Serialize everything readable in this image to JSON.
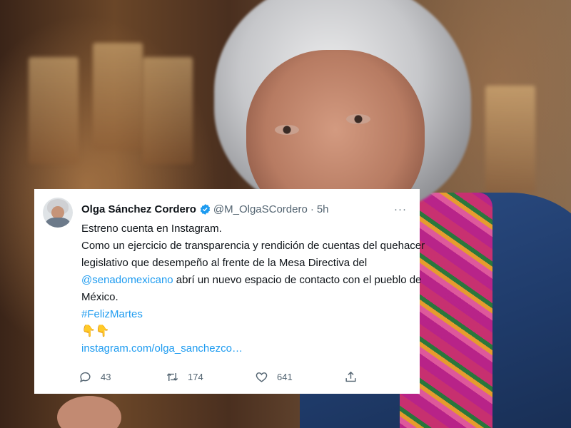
{
  "tweet": {
    "author_name": "Olga Sánchez Cordero",
    "handle": "@M_OlgaSCordero",
    "separator": "·",
    "time": "5h",
    "more": "···",
    "lines": [
      "Estreno cuenta en Instagram.",
      "Como un ejercicio de transparencia y rendición de cuentas del quehacer",
      "legislativo que desempeño al frente de la Mesa Directiva del"
    ],
    "mention": "@senadomexicano",
    "mention_rest": " abrí un nuevo espacio de contacto con el pueblo de",
    "line_mexico": "México.",
    "hashtag": "#FelizMartes",
    "emoji": "👇👇",
    "url": "instagram.com/olga_sanchezco…",
    "replies": "43",
    "retweets": "174",
    "likes": "641"
  },
  "colors": {
    "link": "#1d9bf0",
    "text": "#0f1419",
    "secondary": "#536471",
    "verified": "#1d9bf0"
  },
  "icons": [
    "verified-badge-icon",
    "more-icon",
    "reply-icon",
    "retweet-icon",
    "like-icon",
    "share-icon"
  ]
}
